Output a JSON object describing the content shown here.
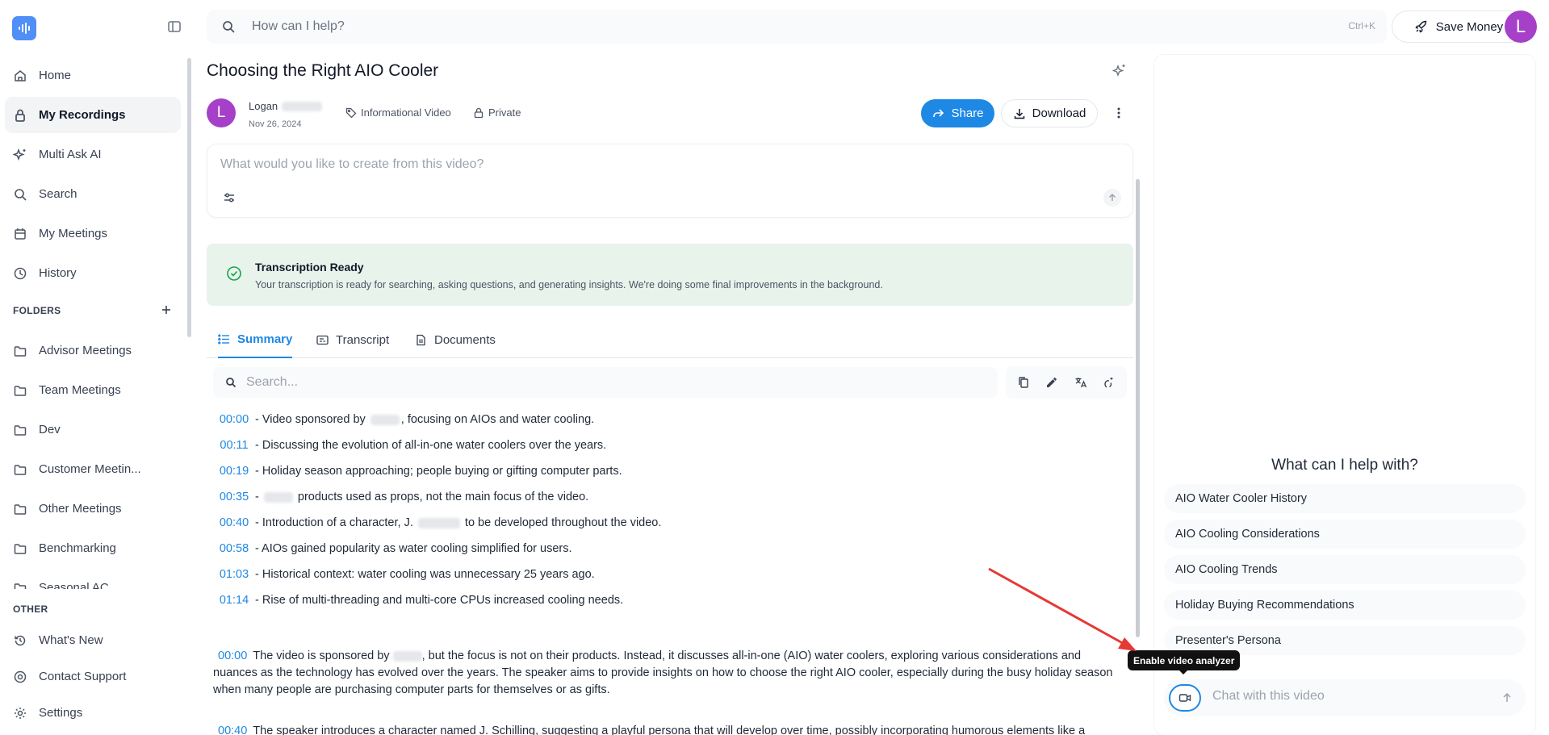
{
  "sidebar": {
    "nav": [
      {
        "label": "Home",
        "icon": "home-icon"
      },
      {
        "label": "My Recordings",
        "icon": "lock-icon",
        "active": true
      },
      {
        "label": "Multi Ask AI",
        "icon": "sparkle-icon"
      },
      {
        "label": "Search",
        "icon": "search-icon"
      },
      {
        "label": "My Meetings",
        "icon": "calendar-icon"
      },
      {
        "label": "History",
        "icon": "clock-icon"
      }
    ],
    "folders_heading": "FOLDERS",
    "folders": [
      {
        "label": "Advisor Meetings"
      },
      {
        "label": "Team Meetings"
      },
      {
        "label": "Dev"
      },
      {
        "label": "Customer Meetin..."
      },
      {
        "label": "Other Meetings"
      },
      {
        "label": "Benchmarking"
      },
      {
        "label": "Seasonal AC..."
      }
    ],
    "other_heading": "OTHER",
    "other": [
      {
        "label": "What's New",
        "icon": "history-icon"
      },
      {
        "label": "Contact Support",
        "icon": "support-icon"
      },
      {
        "label": "Settings",
        "icon": "gear-icon"
      }
    ]
  },
  "topbar": {
    "search_placeholder": "How can I help?",
    "shortcut": "Ctrl+K",
    "save_money_label": "Save Money",
    "avatar_initial": "L"
  },
  "recording": {
    "title": "Choosing the Right AIO Cooler",
    "author_initial": "L",
    "author_name": "Logan",
    "date": "Nov 26, 2024",
    "category": "Informational Video",
    "visibility": "Private",
    "share_label": "Share",
    "download_label": "Download"
  },
  "create": {
    "placeholder": "What would you like to create from this video?"
  },
  "notice": {
    "title": "Transcription Ready",
    "text": "Your transcription is ready for searching, asking questions, and generating insights. We're doing some final improvements in the background."
  },
  "tabs": [
    {
      "label": "Summary",
      "active": true
    },
    {
      "label": "Transcript"
    },
    {
      "label": "Documents"
    }
  ],
  "summary": {
    "search_placeholder": "Search...",
    "lines": [
      {
        "time": "00:00",
        "before": "- Video sponsored by ",
        "after": ", focusing on AIOs and water cooling."
      },
      {
        "time": "00:11",
        "before": "- Discussing the evolution of all-in-one water coolers over the years.",
        "after": ""
      },
      {
        "time": "00:19",
        "before": "- Holiday season approaching; people buying or gifting computer parts.",
        "after": ""
      },
      {
        "time": "00:35",
        "before": "- ",
        "after": " products used as props, not the main focus of the video."
      },
      {
        "time": "00:40",
        "before": "- Introduction of a character, J. ",
        "after": " to be developed throughout the video."
      },
      {
        "time": "00:58",
        "before": "- AIOs gained popularity as water cooling simplified for users.",
        "after": ""
      },
      {
        "time": "01:03",
        "before": "- Historical context: water cooling was unnecessary 25 years ago.",
        "after": ""
      },
      {
        "time": "01:14",
        "before": "- Rise of multi-threading and multi-core CPUs increased cooling needs.",
        "after": ""
      }
    ],
    "paragraph": {
      "time": "00:00",
      "before": "The video is sponsored by ",
      "after": ", but the focus is not on their products. Instead, it discusses all-in-one (AIO) water coolers, exploring various considerations and nuances as the technology has evolved over the years. The speaker aims to provide insights on how to choose the right AIO cooler, especially during the busy holiday season when many people are purchasing computer parts for themselves or as gifts."
    },
    "paragraph2": {
      "time": "00:40",
      "text": "The speaker introduces a character named J. Schilling, suggesting a playful persona that will develop over time, possibly incorporating humorous elements like a"
    }
  },
  "chat": {
    "heading": "What can I help with?",
    "suggestions": [
      "AIO Water Cooler History",
      "AIO Cooling Considerations",
      "AIO Cooling Trends",
      "Holiday Buying Recommendations",
      "Presenter's Persona"
    ],
    "input_placeholder": "Chat with this video",
    "tooltip": "Enable video analyzer"
  },
  "colors": {
    "accent": "#1e88e5",
    "avatar": "#a640c8",
    "success_bg": "#e8f3ec",
    "annotation_arrow": "#e53935"
  }
}
